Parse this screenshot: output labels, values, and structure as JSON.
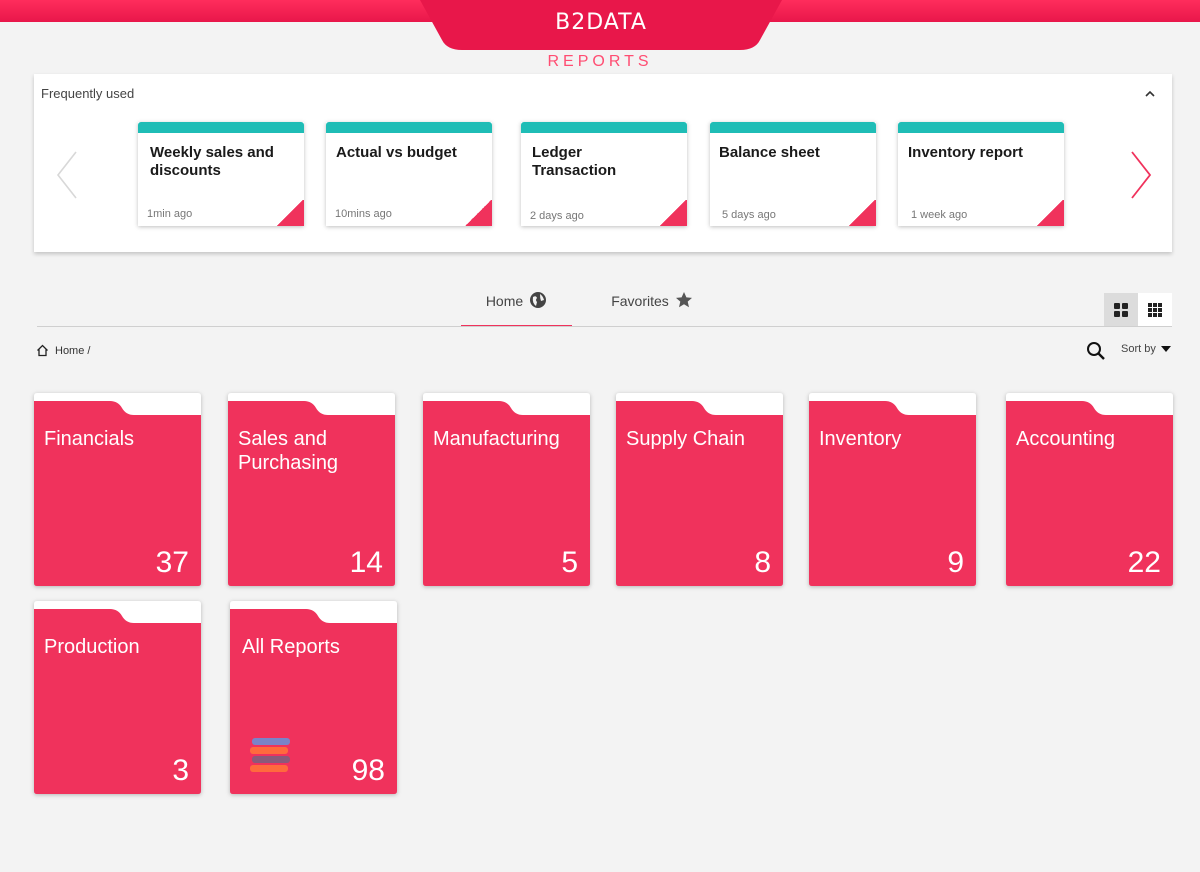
{
  "header": {
    "brand": "B2DATA",
    "section": "REPORTS",
    "accent": "#f0325c",
    "teal": "#1fbdb6"
  },
  "frequently_used": {
    "title": "Frequently used",
    "cards": [
      {
        "title": "Weekly sales and discounts",
        "time": "1min ago"
      },
      {
        "title": "Actual vs budget",
        "time": "10mins ago"
      },
      {
        "title": "Ledger Transaction",
        "time": "2 days ago"
      },
      {
        "title": "Balance sheet",
        "time": "5 days ago"
      },
      {
        "title": "Inventory report",
        "time": "1 week ago"
      }
    ]
  },
  "tabs": [
    {
      "label": "Home",
      "icon": "globe-icon",
      "active": true
    },
    {
      "label": "Favorites",
      "icon": "star-icon",
      "active": false
    }
  ],
  "breadcrumb": {
    "text": "Home /"
  },
  "sort": {
    "label": "Sort by"
  },
  "folders": [
    {
      "name": "Financials",
      "count": "37"
    },
    {
      "name": "Sales and Purchasing",
      "count": "14"
    },
    {
      "name": "Manufacturing",
      "count": "5"
    },
    {
      "name": "Supply Chain",
      "count": "8"
    },
    {
      "name": "Inventory",
      "count": "9"
    },
    {
      "name": "Accounting",
      "count": "22"
    },
    {
      "name": "Production",
      "count": "3"
    },
    {
      "name": "All Reports",
      "count": "98"
    }
  ]
}
